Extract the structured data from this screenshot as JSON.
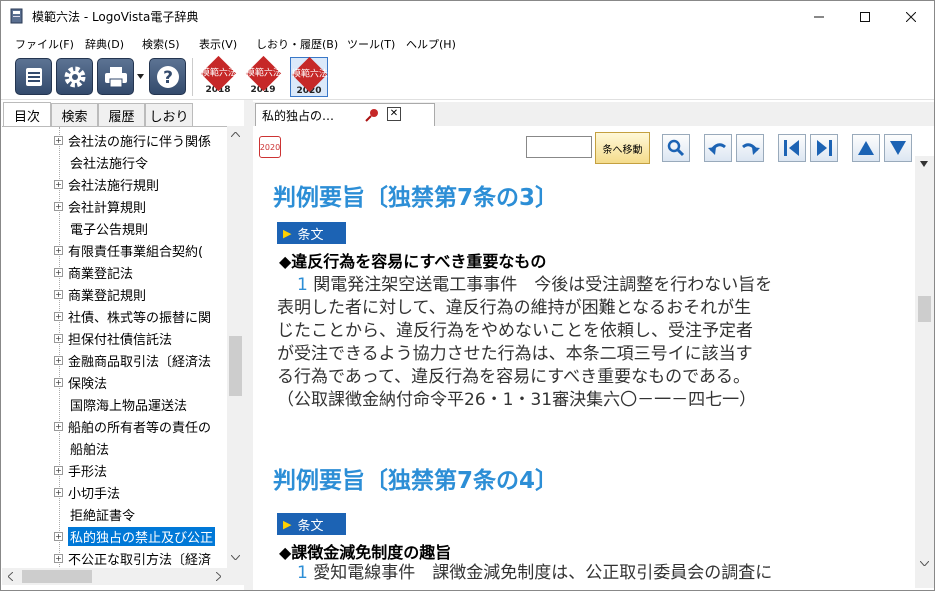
{
  "window": {
    "title": "模範六法 - LogoVista電子辞典"
  },
  "menu": [
    "ファイル(F)",
    "辞典(D)",
    "検索(S)",
    "表示(V)",
    "しおり・履歴(B)",
    "ツール(T)",
    "ヘルプ(H)"
  ],
  "toolbar": {
    "dicts": [
      {
        "mark": "模範六法",
        "year": "2018"
      },
      {
        "mark": "模範六法",
        "year": "2019"
      },
      {
        "mark": "模範六法",
        "year": "2020"
      }
    ]
  },
  "left_tabs": [
    "目次",
    "検索",
    "履歴",
    "しおり"
  ],
  "tree": [
    "会社法の施行に伴う関係",
    "会社法施行令",
    "会社法施行規則",
    "会社計算規則",
    "電子公告規則",
    "有限責任事業組合契約(",
    "商業登記法",
    "商業登記規則",
    "社債、株式等の振替に関",
    "担保付社債信託法",
    "金融商品取引法〔経済法",
    "保険法",
    "国際海上物品運送法",
    "船舶の所有者等の責任の",
    "船舶法",
    "手形法",
    "小切手法",
    "拒絶証書令",
    "私的独占の禁止及び公正",
    "不公正な取引方法〔経済"
  ],
  "doc_tab": {
    "label": "私的独占の…",
    "close": "✕"
  },
  "doc_toolbar": {
    "year_label": "2020",
    "search_value": "",
    "goto_label": "条へ移動"
  },
  "content": {
    "section1": {
      "heading": "判例要旨〔独禁第7条の3〕",
      "badge": "条文",
      "subheading": "◆違反行為を容易にすべき重要なもの",
      "num": "1",
      "lines": [
        "関電発注架空送電工事事件　今後は受注調整を行わない旨を",
        "表明した者に対して、違反行為の維持が困難となるおそれが生",
        "じたことから、違反行為をやめないことを依頼し、受注予定者",
        "が受注できるよう協力させた行為は、本条二項三号イに該当す",
        "る行為であって、違反行為を容易にすべき重要なものである。",
        "（公取課徴金納付命令平26・1・31審決集六〇－一－四七一）"
      ]
    },
    "section2": {
      "heading": "判例要旨〔独禁第7条の4〕",
      "badge": "条文",
      "subheading": "◆課徴金減免制度の趣旨",
      "num": "1",
      "lines": [
        "愛知電線事件　課徴金減免制度は、公正取引委員会の調査に"
      ]
    }
  },
  "colors": {
    "accent": "#2c8ed6",
    "badge": "#1c63b4",
    "selection": "#0078d7",
    "dict_red": "#c62828"
  }
}
